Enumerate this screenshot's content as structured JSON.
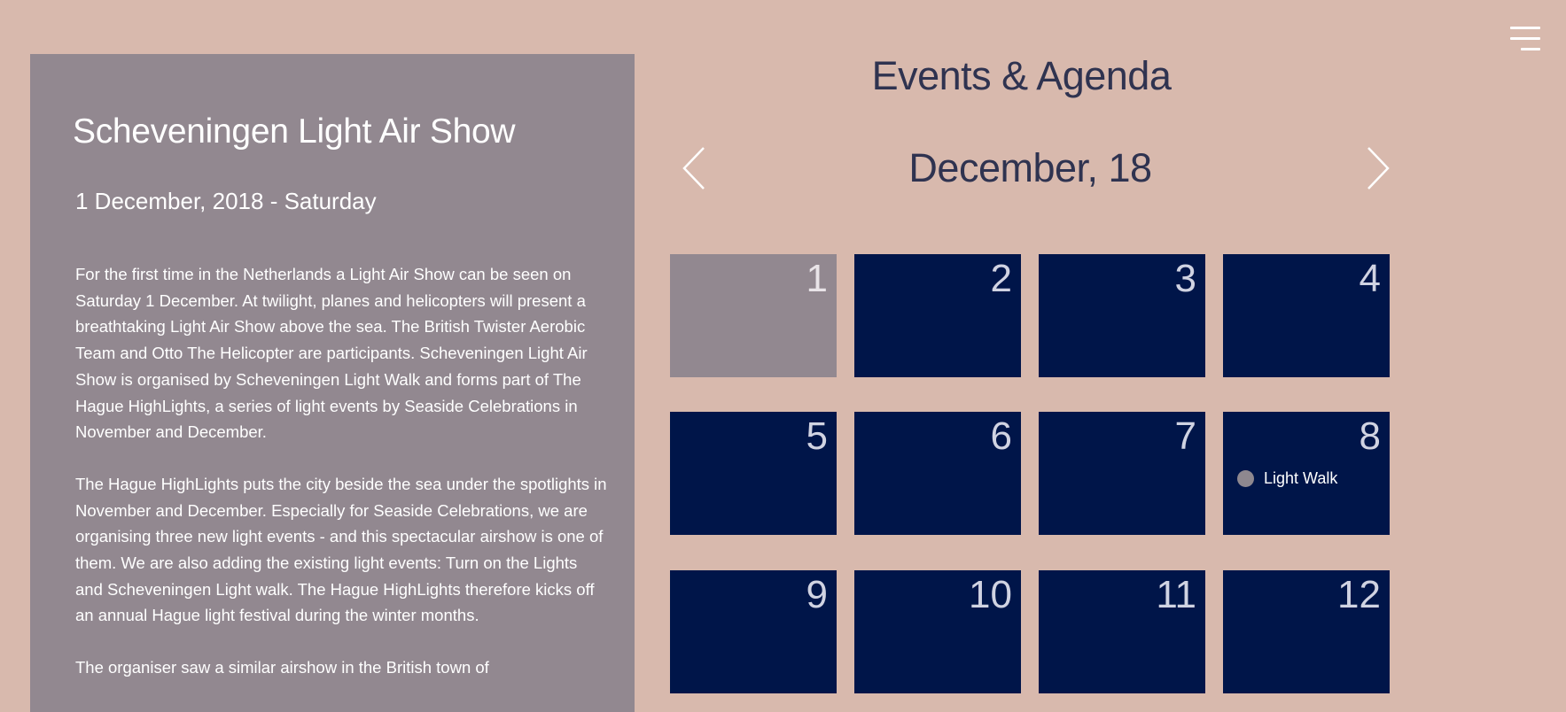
{
  "menu": {
    "icon": "hamburger-menu-icon"
  },
  "event": {
    "title": "Scheveningen Light Air Show",
    "date": "1 December, 2018 - Saturday",
    "paragraphs": [
      "For the first time in the Netherlands a Light Air Show can be seen on Saturday 1 December. At twilight, planes and helicopters will present a breathtaking Light Air Show above the sea. The British Twister Aerobic Team and Otto The Helicopter are participants. Scheveningen Light Air Show is organised by Scheveningen Light Walk and forms part of The Hague HighLights, a series of light events by Seaside Celebrations in November and December.",
      "The Hague HighLights puts the city beside the sea under the spotlights in November and December. Especially for Seaside Celebrations, we are organising three new light events - and this spectacular airshow is one of them. We are also adding the existing light events: Turn on the Lights and Scheveningen Light walk. The Hague HighLights therefore kicks off an annual Hague light festival during the winter months.",
      "The organiser saw a similar airshow in the British town of"
    ]
  },
  "agenda": {
    "title": "Events & Agenda",
    "month": "December, 18",
    "prev_icon": "chevron-left-icon",
    "next_icon": "chevron-right-icon",
    "days": [
      {
        "number": "1",
        "active": true
      },
      {
        "number": "2"
      },
      {
        "number": "3"
      },
      {
        "number": "4"
      },
      {
        "number": "5"
      },
      {
        "number": "6"
      },
      {
        "number": "7"
      },
      {
        "number": "8",
        "event": "Light Walk"
      },
      {
        "number": "9"
      },
      {
        "number": "10"
      },
      {
        "number": "11"
      },
      {
        "number": "12"
      }
    ]
  },
  "colors": {
    "background": "#d8b9ad",
    "panel": "#928890",
    "day_cell": "#001549",
    "heading_text": "#2f3350",
    "event_dot": "#8e888f"
  }
}
